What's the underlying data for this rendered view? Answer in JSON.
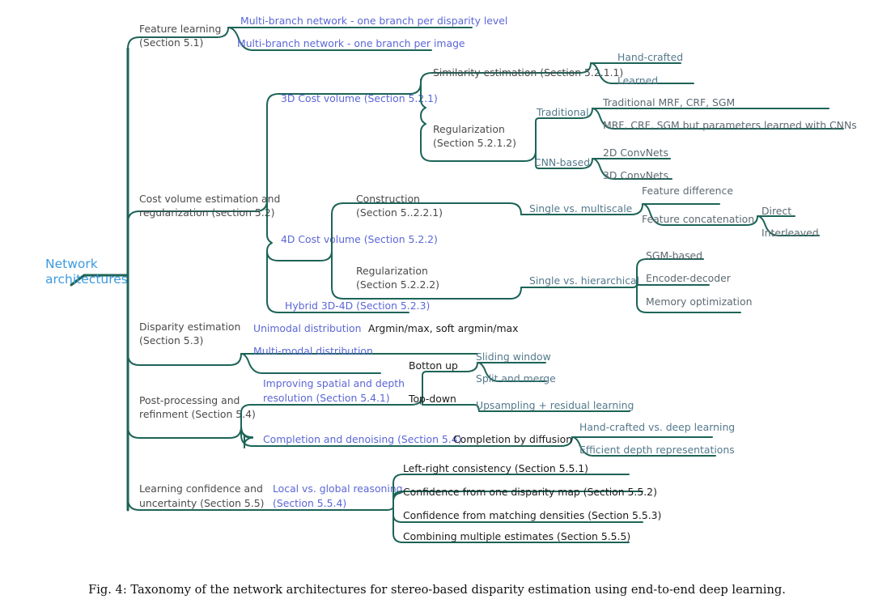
{
  "figure": {
    "caption": "Fig. 4:  Taxonomy of the network architectures for stereo-based disparity estimation using end-to-end deep learning.",
    "colors": {
      "branch": "#1d6457",
      "root_text": "#3d9ae0",
      "blue_text": "#5b67d6",
      "dark_text": "#4a4a4a",
      "slate_text": "#54798c",
      "gray_text": "#5d6a72",
      "black_text": "#1b1b1b",
      "background": "#ffffff"
    }
  },
  "tree": {
    "root": {
      "line1": "Network",
      "line2": "architectures"
    },
    "nodes": {
      "feature_learning": {
        "line1": "Feature learning",
        "line2": "(Section 5.1)"
      },
      "multibranch_disparity": "Multi-branch network - one branch per disparity level",
      "multibranch_image": "Multi-branch network - one branch per image",
      "cost_volume": {
        "line1": "Cost volume estimation and",
        "line2": "regularization (section 5.2)"
      },
      "cv3d": "3D Cost volume (Section 5.2.1)",
      "similarity_estimation": "Similarity estimation (Section 5.2.1.1)",
      "hand_crafted": "Hand-crafted",
      "learned": "Learned",
      "regularization_3d": {
        "line1": "Regularization",
        "line2": "(Section 5.2.1.2)"
      },
      "traditional": "Traditional",
      "traditional_mrf": "Traditional MRF, CRF, SGM",
      "mrf_learned_cnn": "MRF, CRF, SGM but parameters learned with CNNs",
      "cnn_based": "CNN-based",
      "convnets_2d": "2D ConvNets",
      "convnets_3d": "3D ConvNets",
      "cv4d": "4D Cost volume (Section 5.2.2)",
      "construction": {
        "line1": "Construction",
        "line2": "(Section 5..2.2.1)"
      },
      "single_vs_multiscale": "Single vs. multiscale",
      "feature_difference": "Feature difference",
      "feature_concatenation": "Feature concatenation",
      "direct": "Direct",
      "interleaved": "Interleaved",
      "regularization_4d": {
        "line1": "Regularization",
        "line2": "(Section 5.2.2.2)"
      },
      "single_vs_hierarchical": "Single vs. hierarchical",
      "sgm_based": "SGM-based",
      "encoder_decoder": "Encoder-decoder",
      "memory_optimization": "Memory optimization",
      "hybrid": "Hybrid 3D-4D (Section 5.2.3)",
      "disparity_estimation": {
        "line1": "Disparity estimation",
        "line2": "(Section 5.3)"
      },
      "unimodal": "Unimodal distribution",
      "argmin_max": "Argmin/max, soft argmin/max",
      "multimodal": "Multi-modal distribution",
      "post_processing": {
        "line1": "Post-processing and",
        "line2": "refinment (Section 5.4)"
      },
      "improving_resolution": {
        "line1": "Improving spatial and depth",
        "line2": "resolution (Section 5.4.1)"
      },
      "bottom_up": "Botton up",
      "sliding_window": "Sliding window",
      "split_and_merge": "Split and merge",
      "top_down": "Top-down",
      "upsampling_residual": "Upsampling + residual learning",
      "completion_denoising": "Completion and denoising (Section 5.4)",
      "completion_diffusion": "Completion by diffusion",
      "handcrafted_vs_deep": "Hand-crafted vs. deep learning",
      "efficient_depth": "Efficient depth representations",
      "learning_confidence": {
        "line1": "Learning confidence and",
        "line2": "uncertainty (Section 5.5)"
      },
      "local_vs_global": {
        "line1": "Local vs. global reasoning",
        "line2": "(Section 5.5.4)"
      },
      "left_right_consistency": "Left-right consistency (Section 5.5.1)",
      "confidence_one_map": "Confidence from one disparity map (Section 5.5.2)",
      "confidence_matching": "Confidence from matching densities (Section 5.5.3)",
      "combining_estimates": "Combining multiple estimates (Section 5.5.5)"
    }
  }
}
